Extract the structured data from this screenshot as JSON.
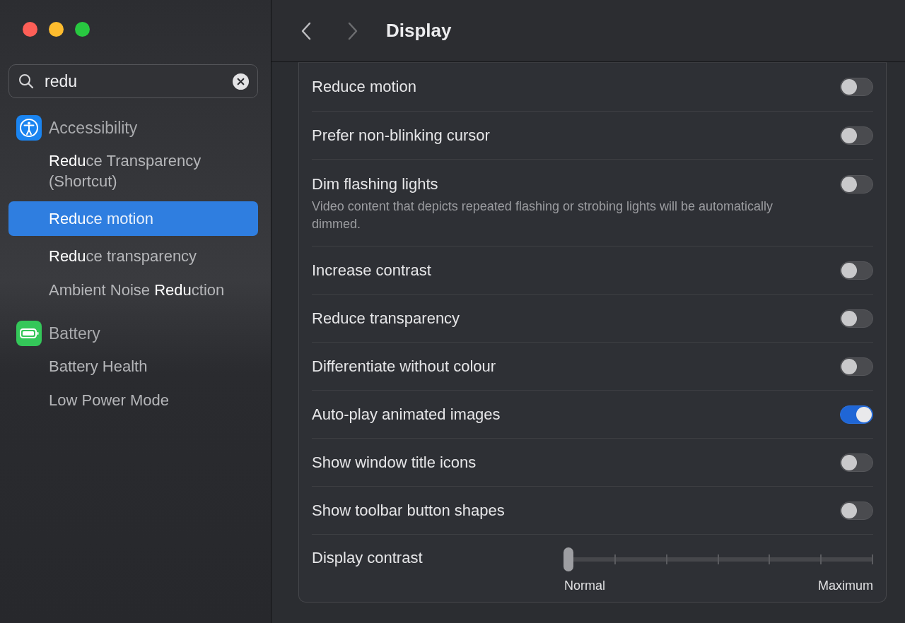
{
  "window": {
    "title": "Display"
  },
  "search": {
    "value": "redu"
  },
  "sidebar": {
    "groups": [
      {
        "label": "Accessibility",
        "kind": "accessibility",
        "items": [
          {
            "label": "**Redu**ce Transparency (Shortcut)",
            "selected": false
          },
          {
            "label": "**Redu**ce motion",
            "selected": true
          },
          {
            "label": "**Redu**ce transparency",
            "selected": false
          },
          {
            "label": "Ambient Noise **Redu**ction",
            "selected": false
          }
        ]
      },
      {
        "label": "Battery",
        "kind": "battery",
        "items": [
          {
            "label": "Battery Health",
            "selected": false
          },
          {
            "label": "Low Power Mode",
            "selected": false
          }
        ]
      }
    ]
  },
  "settings": [
    {
      "kind": "toggle",
      "label": "Reduce motion",
      "on": false
    },
    {
      "kind": "toggle",
      "label": "Prefer non-blinking cursor",
      "on": false
    },
    {
      "kind": "toggle",
      "label": "Dim flashing lights",
      "description": "Video content that depicts repeated flashing or strobing lights will be automatically dimmed.",
      "on": false
    },
    {
      "kind": "toggle",
      "label": "Increase contrast",
      "on": false
    },
    {
      "kind": "toggle",
      "label": "Reduce transparency",
      "on": false
    },
    {
      "kind": "toggle",
      "label": "Differentiate without colour",
      "on": false
    },
    {
      "kind": "toggle",
      "label": "Auto-play animated images",
      "on": true
    },
    {
      "kind": "toggle",
      "label": "Show window title icons",
      "on": false
    },
    {
      "kind": "toggle",
      "label": "Show toolbar button shapes",
      "on": false
    },
    {
      "kind": "slider",
      "label": "Display contrast",
      "level": 0,
      "min_label": "Normal",
      "max_label": "Maximum"
    }
  ]
}
